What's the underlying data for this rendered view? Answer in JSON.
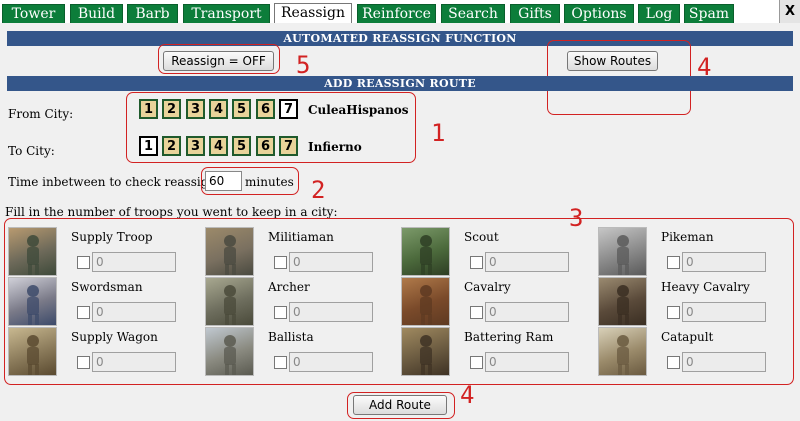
{
  "tabs": [
    {
      "label": "Tower",
      "active": false
    },
    {
      "label": "Build",
      "active": false
    },
    {
      "label": "Barb",
      "active": false
    },
    {
      "label": "Transport",
      "active": false
    },
    {
      "label": "Reassign",
      "active": true
    },
    {
      "label": "Reinforce",
      "active": false
    },
    {
      "label": "Search",
      "active": false
    },
    {
      "label": "Gifts",
      "active": false
    },
    {
      "label": "Options",
      "active": false
    },
    {
      "label": "Log",
      "active": false
    },
    {
      "label": "Spam",
      "active": false
    }
  ],
  "close_label": "X",
  "automated": {
    "header": "AUTOMATED REASSIGN FUNCTION",
    "reassign_toggle_label": "Reassign = OFF",
    "show_routes_label": "Show Routes"
  },
  "add_route": {
    "header": "ADD REASSIGN ROUTE",
    "from_label": "From City:",
    "to_label": "To City:",
    "city_numbers": [
      "1",
      "2",
      "3",
      "4",
      "5",
      "6",
      "7"
    ],
    "from_selected": 7,
    "to_selected": 1,
    "from_city_name": "CuleaHispanos",
    "to_city_name": "Infierno",
    "interval_label": "Time inbetween to check reassign:",
    "interval_value": "60",
    "interval_unit": "minutes",
    "troops_prompt": "Fill in the number of troops you went to keep in a city:",
    "add_route_label": "Add Route"
  },
  "troops": [
    {
      "name": "Supply Troop",
      "value": "0"
    },
    {
      "name": "Militiaman",
      "value": "0"
    },
    {
      "name": "Scout",
      "value": "0"
    },
    {
      "name": "Pikeman",
      "value": "0"
    },
    {
      "name": "Swordsman",
      "value": "0"
    },
    {
      "name": "Archer",
      "value": "0"
    },
    {
      "name": "Cavalry",
      "value": "0"
    },
    {
      "name": "Heavy Cavalry",
      "value": "0"
    },
    {
      "name": "Supply Wagon",
      "value": "0"
    },
    {
      "name": "Ballista",
      "value": "0"
    },
    {
      "name": "Battering Ram",
      "value": "0"
    },
    {
      "name": "Catapult",
      "value": "0"
    }
  ],
  "annotations": [
    "1",
    "2",
    "3",
    "4",
    "4",
    "5"
  ],
  "colors": {
    "tab_bg": "#0c7d3a",
    "header_bg": "#34568a",
    "annotation_red": "#d22222",
    "city_tile": "#e8d39a"
  }
}
